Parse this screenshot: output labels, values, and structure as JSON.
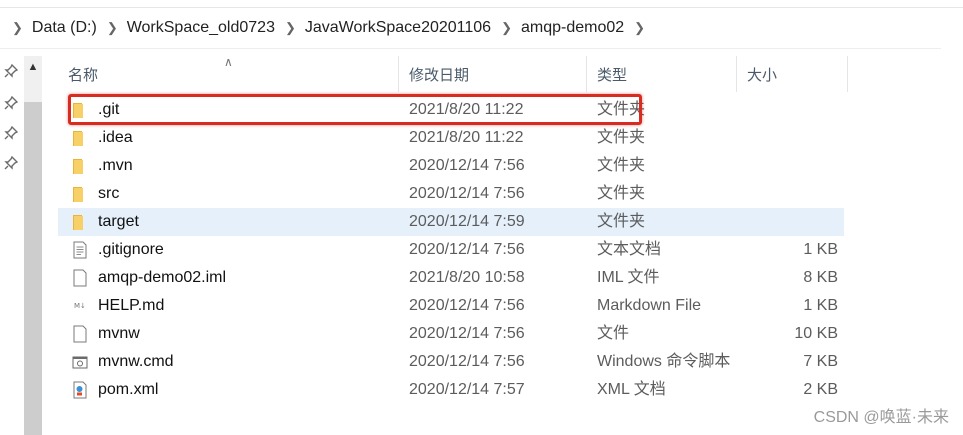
{
  "breadcrumb": [
    "Data (D:)",
    "WorkSpace_old0723",
    "JavaWorkSpace20201106",
    "amqp-demo02"
  ],
  "columns": {
    "name": "名称",
    "date": "修改日期",
    "type": "类型",
    "size": "大小"
  },
  "files": [
    {
      "name": ".git",
      "date": "2021/8/20 11:22",
      "type": "文件夹",
      "size": "",
      "icon": "folder-icon"
    },
    {
      "name": ".idea",
      "date": "2021/8/20 11:22",
      "type": "文件夹",
      "size": "",
      "icon": "folder-icon"
    },
    {
      "name": ".mvn",
      "date": "2020/12/14 7:56",
      "type": "文件夹",
      "size": "",
      "icon": "folder-icon"
    },
    {
      "name": "src",
      "date": "2020/12/14 7:56",
      "type": "文件夹",
      "size": "",
      "icon": "folder-icon"
    },
    {
      "name": "target",
      "date": "2020/12/14 7:59",
      "type": "文件夹",
      "size": "",
      "icon": "folder-icon",
      "selected": true
    },
    {
      "name": ".gitignore",
      "date": "2020/12/14 7:56",
      "type": "文本文档",
      "size": "1 KB",
      "icon": "text-file-icon"
    },
    {
      "name": "amqp-demo02.iml",
      "date": "2021/8/20 10:58",
      "type": "IML 文件",
      "size": "8 KB",
      "icon": "blank-file-icon"
    },
    {
      "name": "HELP.md",
      "date": "2020/12/14 7:56",
      "type": "Markdown File",
      "size": "1 KB",
      "icon": "markdown-file-icon"
    },
    {
      "name": "mvnw",
      "date": "2020/12/14 7:56",
      "type": "文件",
      "size": "10 KB",
      "icon": "blank-file-icon"
    },
    {
      "name": "mvnw.cmd",
      "date": "2020/12/14 7:56",
      "type": "Windows 命令脚本",
      "size": "7 KB",
      "icon": "cmd-file-icon"
    },
    {
      "name": "pom.xml",
      "date": "2020/12/14 7:57",
      "type": "XML 文档",
      "size": "2 KB",
      "icon": "xml-file-icon"
    }
  ],
  "watermark": "CSDN @唤蓝·未来",
  "colors": {
    "selection": "#e5f0fb",
    "highlight_border": "#d92b20",
    "folder": "#f0c64a"
  }
}
